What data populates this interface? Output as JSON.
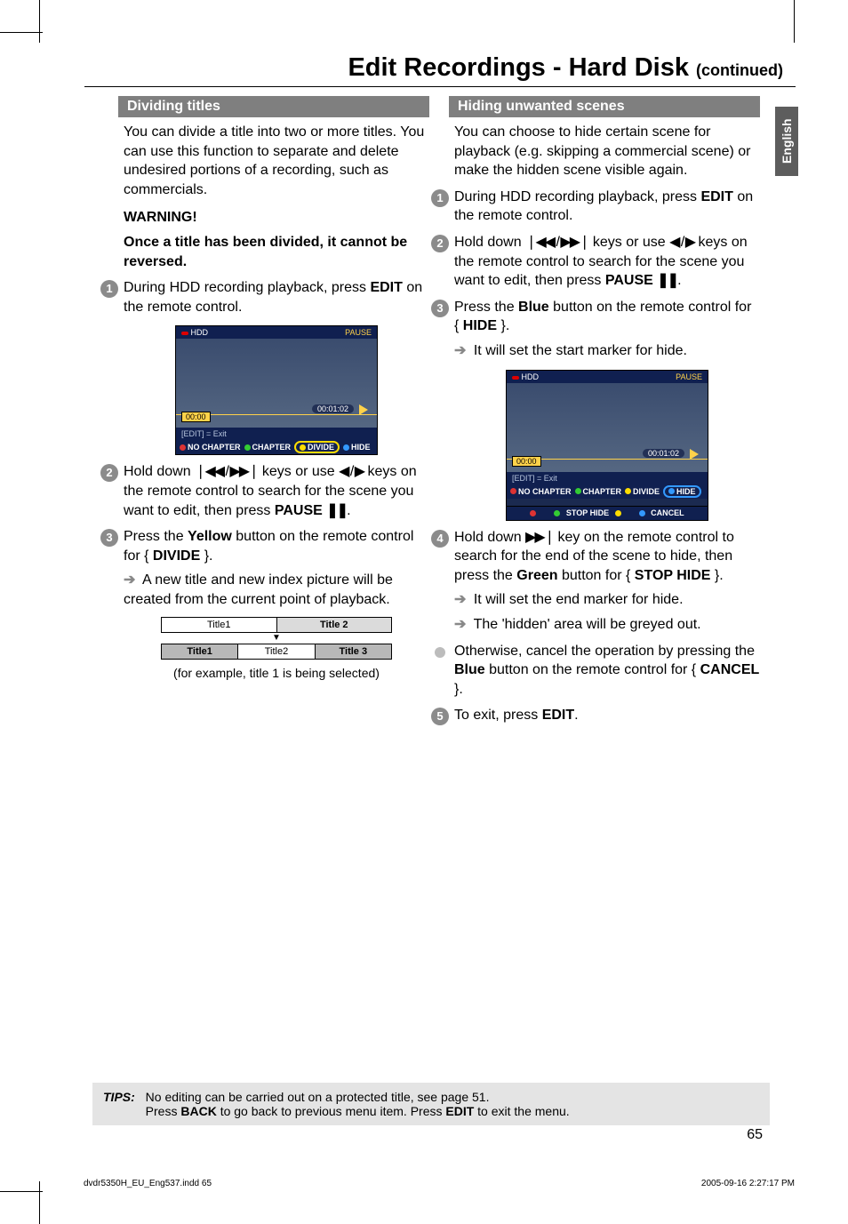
{
  "title_main": "Edit Recordings - Hard Disk ",
  "title_cont": "(continued)",
  "lang_tab": "English",
  "left": {
    "section_heading": "Dividing titles",
    "intro": "You can divide a title into two or more titles. You can use this function to separate and delete undesired portions of a recording, such as commercials.",
    "warn_head": "WARNING!",
    "warn_body": "Once a title has been divided, it cannot be reversed.",
    "s1a": "During HDD recording playback, press ",
    "s1b": "EDIT",
    "s1c": " on the remote control.",
    "ss": {
      "hdd": "HDD",
      "pause": "PAUSE",
      "time_pill": "00:01:02",
      "yellow_time": "00:00",
      "edit_exit": "[EDIT] = Exit",
      "no_chapter": "NO CHAPTER",
      "chapter": "CHAPTER",
      "divide": "DIVIDE",
      "hide": "HIDE"
    },
    "s2a": "Hold down ",
    "s2b": " keys or use ",
    "s2c": " keys on the remote control to search for the scene you want to edit, then press ",
    "s2d": "PAUSE ",
    "s3a": "Press the ",
    "s3b": "Yellow",
    "s3c": " button on the remote control for { ",
    "s3d": "DIVIDE",
    "s3e": " }.",
    "s3r": " A new title and new index picture will be created from the current point of playback.",
    "td_title1": "Title1",
    "td_title2": "Title 2",
    "td_title2b": "Title2",
    "td_title3": "Title 3",
    "caption": "(for example, title 1 is being selected)"
  },
  "right": {
    "section_heading": "Hiding unwanted scenes",
    "intro": "You can choose to hide certain scene for playback (e.g. skipping a commercial scene) or make the hidden scene visible again.",
    "s1a": "During HDD recording playback, press ",
    "s1b": "EDIT",
    "s1c": " on the remote control.",
    "s2a": "Hold down ",
    "s2b": " keys or use ",
    "s2c": " keys on the remote control to search for the scene you want to edit, then press ",
    "s2d": "PAUSE ",
    "s3a": "Press the ",
    "s3b": "Blue",
    "s3c": " button on the remote control for { ",
    "s3d": "HIDE",
    "s3e": " }.",
    "s3r": " It will set the start marker for hide.",
    "ss": {
      "hdd": "HDD",
      "pause": "PAUSE",
      "time_pill": "00:01:02",
      "yellow_time": "00:00",
      "edit_exit": "[EDIT] = Exit",
      "no_chapter": "NO CHAPTER",
      "chapter": "CHAPTER",
      "divide": "DIVIDE",
      "hide": "HIDE",
      "stop_hide": "STOP HIDE",
      "cancel": "CANCEL"
    },
    "s4a": "Hold down ",
    "s4b": " key on the remote control to search for the end of the scene to hide, then press the ",
    "s4c": "Green",
    "s4d": " button for { ",
    "s4e": "STOP HIDE",
    "s4f": " }.",
    "s4r1": " It will set the end marker for hide.",
    "s4r2": " The 'hidden' area will be greyed out.",
    "s5a": "Otherwise, cancel the operation by pressing the ",
    "s5b": "Blue",
    "s5c": " button on the remote control for { ",
    "s5d": "CANCEL",
    "s5e": " }.",
    "s6a": "To exit, press ",
    "s6b": "EDIT",
    "s6c": "."
  },
  "tips": {
    "label": "TIPS:",
    "l1a": "No editing can be carried out on a protected title, see page 51.",
    "l2a": "Press ",
    "l2b": "BACK",
    "l2c": " to go back to previous menu item. Press ",
    "l2d": "EDIT",
    "l2e": " to exit the menu."
  },
  "page_num": "65",
  "footer_file": "dvdr5350H_EU_Eng537.indd   65",
  "footer_time": "2005-09-16   2:27:17 PM",
  "icons": {
    "prev_next": "❘◀◀ / ▶▶❘",
    "left_right": "◀ / ▶",
    "next": "▶▶❘",
    "pause": "❚❚"
  }
}
